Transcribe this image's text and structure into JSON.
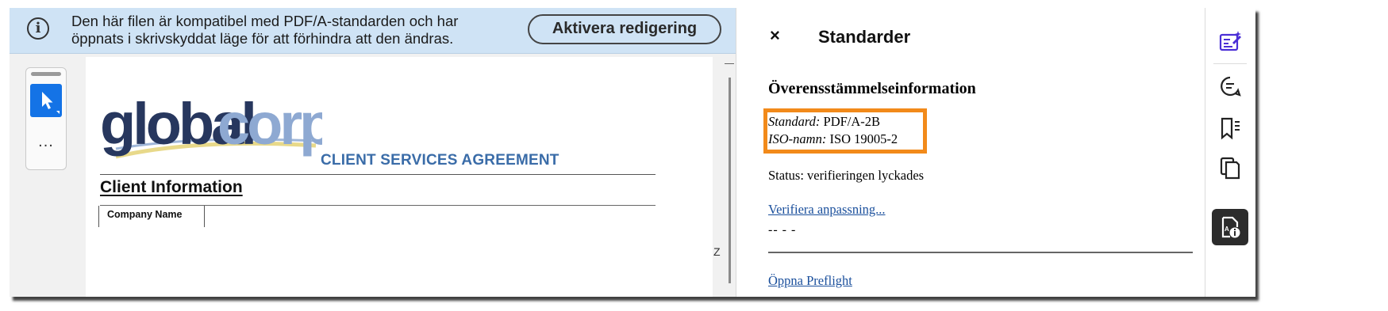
{
  "infobar": {
    "message_line1": "Den här filen är kompatibel med PDF/A-standarden och har",
    "message_line2": "öppnats i skrivskyddat läge för att förhindra att den ändras.",
    "enable_editing_label": "Aktivera redigering",
    "background_color": "#cfe3f5"
  },
  "tools": {
    "select_icon": "pointer-arrow-icon",
    "more_label": "..."
  },
  "document": {
    "logo_text_dark": "global",
    "logo_text_light": "corp",
    "agreement_title": "CLIENT SERVICES AGREEMENT",
    "section_heading": "Client Information",
    "company_name_header": "Company Name",
    "edge_glyph": "Z"
  },
  "panel": {
    "close_label": "×",
    "title": "Standarder",
    "section_title": "Överensstämmelseinformation",
    "standard_label": "Standard:",
    "standard_value": "PDF/A-2B",
    "iso_label": "ISO-namn:",
    "iso_value": "ISO 19005-2",
    "status_text": "Status: verifieringen lyckades",
    "verify_link": "Verifiera anpassning...",
    "dashes_text": "-- -           -",
    "preflight_link": "Öppna Preflight",
    "highlight_color": "#f28a1a"
  },
  "rail": {
    "icons": [
      "edit-pdf-icon",
      "comment-icon",
      "bookmarks-icon",
      "pages-icon",
      "standards-icon"
    ],
    "active_index": 4,
    "accent_color": "#4b2fd6"
  }
}
